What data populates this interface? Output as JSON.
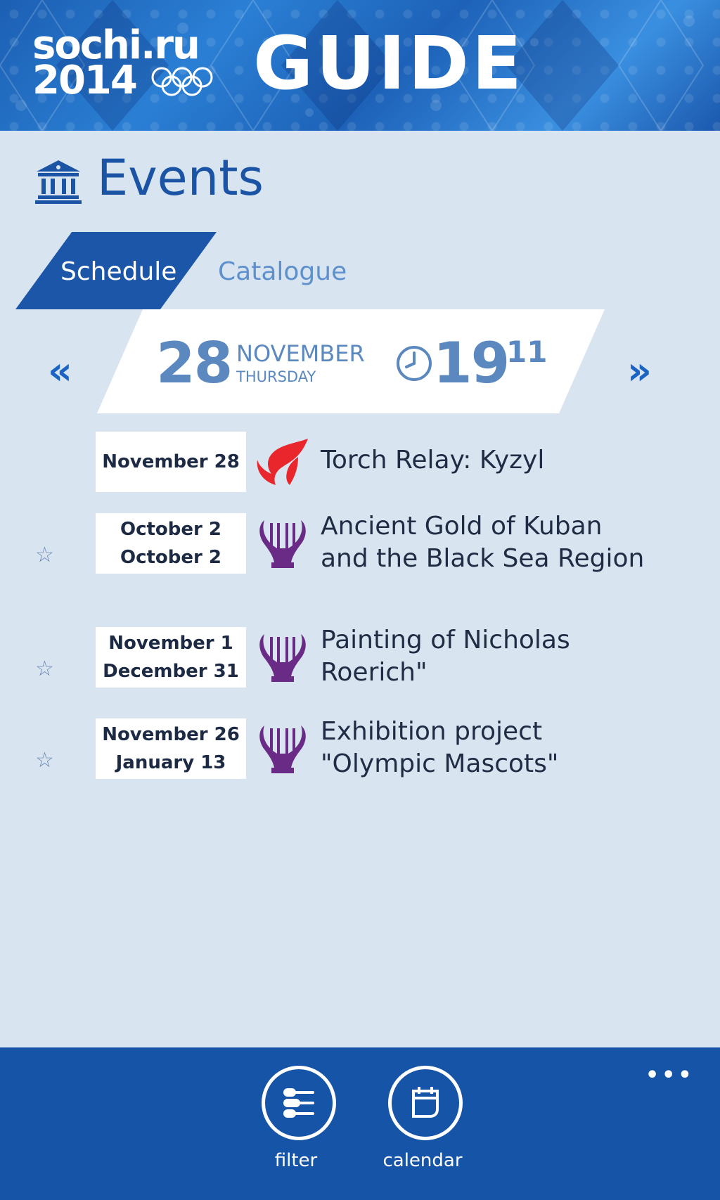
{
  "header": {
    "brand_line1": "sochi.ru",
    "brand_line2": "2014",
    "app_name": "GUIDE"
  },
  "page": {
    "title": "Events",
    "icon": "museum-icon"
  },
  "tabs": [
    {
      "label": "Schedule",
      "active": true
    },
    {
      "label": "Catalogue",
      "active": false
    }
  ],
  "date_bar": {
    "prev_label": "«",
    "next_label": "»",
    "day": "28",
    "month": "NOVEMBER",
    "weekday": "THURSDAY",
    "hour": "19",
    "minute": "11"
  },
  "events": [
    {
      "date_line1": "November 28",
      "date_line2": "",
      "title": "Torch Relay: Kyzyl",
      "icon": "torch-flame-icon",
      "starred": false,
      "has_star": false
    },
    {
      "date_line1": "October 2",
      "date_line2": "October 2",
      "title": "Ancient Gold of Kuban and the Black Sea Region",
      "icon": "lyre-icon",
      "starred": false,
      "has_star": true
    },
    {
      "date_line1": "November 1",
      "date_line2": "December 31",
      "title": "Painting of Nicholas Roerich\"",
      "icon": "lyre-icon",
      "starred": false,
      "has_star": true
    },
    {
      "date_line1": "November 26",
      "date_line2": "January 13",
      "title": "Exhibition project \"Olympic Mascots\"",
      "icon": "lyre-icon",
      "starred": false,
      "has_star": true
    }
  ],
  "appbar": {
    "more_label": "•••",
    "buttons": [
      {
        "label": "filter",
        "icon": "filter-icon"
      },
      {
        "label": "calendar",
        "icon": "calendar-icon"
      }
    ]
  },
  "colors": {
    "brand_blue": "#1b56a8",
    "background": "#d8e5f1",
    "torch_red": "#e8262c",
    "lyre_purple": "#6a2b86"
  }
}
